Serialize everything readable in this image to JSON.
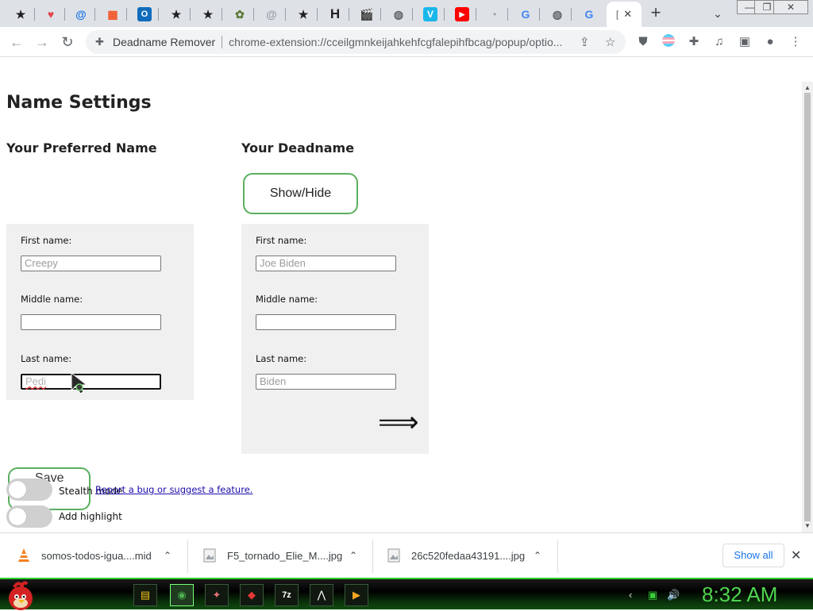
{
  "browser": {
    "tabs": [
      {
        "icon": "★",
        "name": "star"
      },
      {
        "icon": "♥",
        "name": "pocket"
      },
      {
        "icon": "@",
        "name": "at"
      },
      {
        "icon": "▦",
        "name": "microsoft"
      },
      {
        "icon": "O",
        "name": "outlook"
      },
      {
        "icon": "★",
        "name": "star"
      },
      {
        "icon": "★",
        "name": "star"
      },
      {
        "icon": "✿",
        "name": "frog"
      },
      {
        "icon": "@",
        "name": "at-grey"
      },
      {
        "icon": "★",
        "name": "star"
      },
      {
        "icon": "H",
        "name": "h"
      },
      {
        "icon": "🎬",
        "name": "clapper"
      },
      {
        "icon": "◍",
        "name": "globe"
      },
      {
        "icon": "V",
        "name": "v"
      },
      {
        "icon": "▶",
        "name": "youtube"
      },
      {
        "icon": "◔",
        "name": "a"
      },
      {
        "icon": "G",
        "name": "google"
      },
      {
        "icon": "◍",
        "name": "globe"
      },
      {
        "icon": "G",
        "name": "google"
      }
    ],
    "active_tab_label": "[",
    "active_tab_close": "✕",
    "new_tab": "+",
    "tab_search": "⌄",
    "window_controls": {
      "minimize": "—",
      "restore": "❐",
      "close": "✕"
    },
    "omnibox": {
      "site_name": "Deadname Remover",
      "url": "chrome-extension://cceilgmnkeijahkehfcgfalepihfbcag/popup/optio..."
    }
  },
  "page": {
    "title": "Name Settings",
    "preferred": {
      "heading": "Your Preferred Name",
      "first_label": "First name:",
      "first_value": "Creepy",
      "middle_label": "Middle name:",
      "middle_value": "",
      "last_label": "Last name:",
      "last_value": "Pedi"
    },
    "deadname": {
      "heading": "Your Deadname",
      "show_hide": "Show/Hide",
      "first_label": "First name:",
      "first_value": "Joe Biden",
      "middle_label": "Middle name:",
      "middle_value": "",
      "last_label": "Last name:",
      "last_value": "Biden",
      "arrow": "⟹"
    },
    "save_label": "Save",
    "stealth_label": "Stealth mode",
    "highlight_label": "Add highlight",
    "report_link": "Report a bug or suggest a feature."
  },
  "downloads": {
    "items": [
      {
        "name": "somos-todos-igua....mid",
        "icon": "vlc-cone-icon"
      },
      {
        "name": "F5_tornado_Elie_M....jpg",
        "icon": "image-file-icon"
      },
      {
        "name": "26c520fedaa43191....jpg",
        "icon": "image-file-icon"
      }
    ],
    "caret": "⌃",
    "show_all": "Show all",
    "close": "✕"
  },
  "taskbar": {
    "clock": "8:32 AM",
    "apps": [
      "▤",
      "◉",
      "✦",
      "◆",
      "7z",
      "⋀",
      "▶"
    ]
  },
  "colors": {
    "accent_green": "#5aaf5e",
    "link_blue": "#1a0dab",
    "panel_bg": "#f0f0f0",
    "clock_green": "#4fd44f"
  }
}
